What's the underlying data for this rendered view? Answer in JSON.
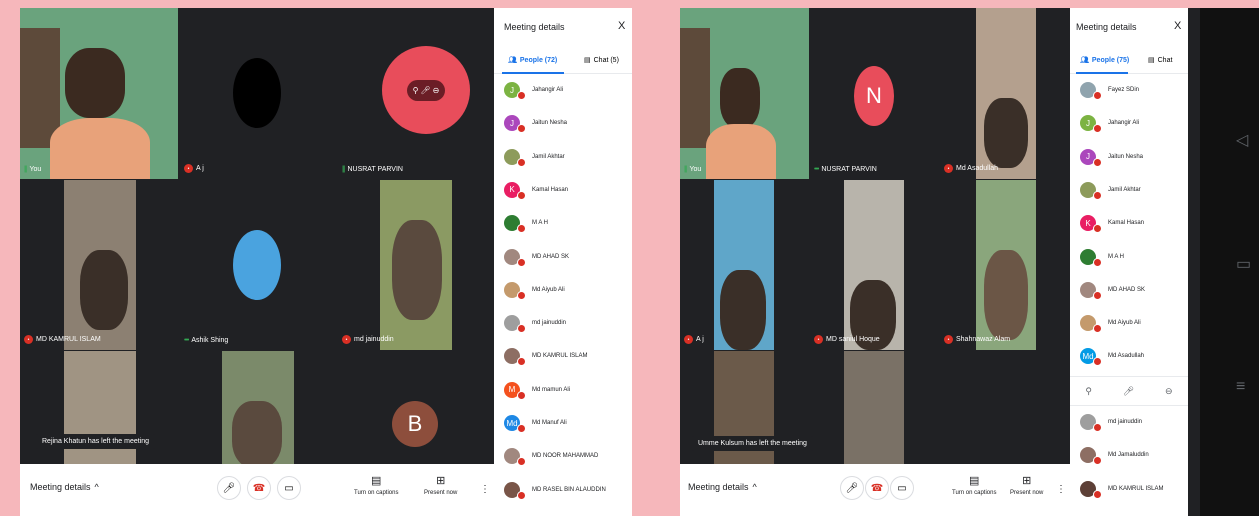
{
  "left": {
    "tiles": [
      {
        "name": "You"
      },
      {
        "name": "A j"
      },
      {
        "name": "NUSRAT PARVIN"
      },
      {
        "name": "MD KAMRUL ISLAM"
      },
      {
        "name": "Ashik Shing"
      },
      {
        "name": "md jainuddin"
      },
      {
        "name": ""
      },
      {
        "name": ""
      },
      {
        "name": "",
        "initial": "B"
      }
    ],
    "toast": "Rejina Khatun has left the meeting",
    "bottom": {
      "meeting_details": "Meeting details",
      "captions": "Turn on captions",
      "present": "Present now"
    },
    "panel": {
      "title": "Meeting details",
      "close": "X",
      "people_tab": "People (72)",
      "chat_tab": "Chat (5)",
      "people": [
        {
          "initial": "J",
          "name": "Jahangir Ali",
          "color": "#7cb342"
        },
        {
          "initial": "J",
          "name": "Jaitun Nesha",
          "color": "#ab47bc"
        },
        {
          "initial": "",
          "name": "Jamil Akhtar",
          "color": "#8d9b5b"
        },
        {
          "initial": "K",
          "name": "Kamal Hasan",
          "color": "#e91e63"
        },
        {
          "initial": "",
          "name": "M A H",
          "color": "#2e7d32"
        },
        {
          "initial": "",
          "name": "MD AHAD SK",
          "color": "#a1887f"
        },
        {
          "initial": "",
          "name": "Md Aiyub Ali",
          "color": "#c49a6c"
        },
        {
          "initial": "",
          "name": "md jainuddin",
          "color": "#9e9e9e"
        },
        {
          "initial": "",
          "name": "MD KAMRUL ISLAM",
          "color": "#8d6e63"
        },
        {
          "initial": "M",
          "name": "Md mamun Ali",
          "color": "#f4511e"
        },
        {
          "initial": "Md",
          "name": "Md Manuf Ali",
          "color": "#1e88e5"
        },
        {
          "initial": "",
          "name": "MD NOOR MAHAMMAD",
          "color": "#a1887f"
        },
        {
          "initial": "",
          "name": "MD RASEL BIN ALAUDDIN",
          "color": "#795548"
        }
      ]
    }
  },
  "right": {
    "tiles": [
      {
        "name": "You"
      },
      {
        "name": "NUSRAT PARVIN",
        "initial": "N"
      },
      {
        "name": "Md Asadullah"
      },
      {
        "name": "A j"
      },
      {
        "name": "MD saniul Hoque"
      },
      {
        "name": "Shahnawaz Alam"
      },
      {
        "name": ""
      },
      {
        "name": ""
      },
      {
        "name": ""
      }
    ],
    "toast": "Umme Kulsum has left the meeting",
    "bottom": {
      "meeting_details": "Meeting details",
      "captions": "Turn on captions",
      "present": "Present now"
    },
    "panel": {
      "title": "Meeting details",
      "close": "X",
      "people_tab": "People (75)",
      "chat_tab": "Chat",
      "people": [
        {
          "initial": "",
          "name": "Fayez SDin",
          "color": "#90a4ae"
        },
        {
          "initial": "J",
          "name": "Jahangir Ali",
          "color": "#7cb342"
        },
        {
          "initial": "J",
          "name": "Jaitun Nesha",
          "color": "#ab47bc"
        },
        {
          "initial": "",
          "name": "Jamil Akhtar",
          "color": "#8d9b5b"
        },
        {
          "initial": "K",
          "name": "Kamal Hasan",
          "color": "#e91e63"
        },
        {
          "initial": "",
          "name": "M A H",
          "color": "#2e7d32"
        },
        {
          "initial": "",
          "name": "MD AHAD SK",
          "color": "#a1887f"
        },
        {
          "initial": "",
          "name": "Md Aiyub Ali",
          "color": "#c49a6c"
        },
        {
          "initial": "Md",
          "name": "Md Asadullah",
          "color": "#039be5"
        }
      ],
      "people_after": [
        {
          "initial": "",
          "name": "md jainuddin",
          "color": "#9e9e9e"
        },
        {
          "initial": "",
          "name": "Md Jamaluddin",
          "color": "#8d6e63"
        },
        {
          "initial": "",
          "name": "MD KAMRUL ISLAM",
          "color": "#5d4037"
        }
      ]
    }
  }
}
